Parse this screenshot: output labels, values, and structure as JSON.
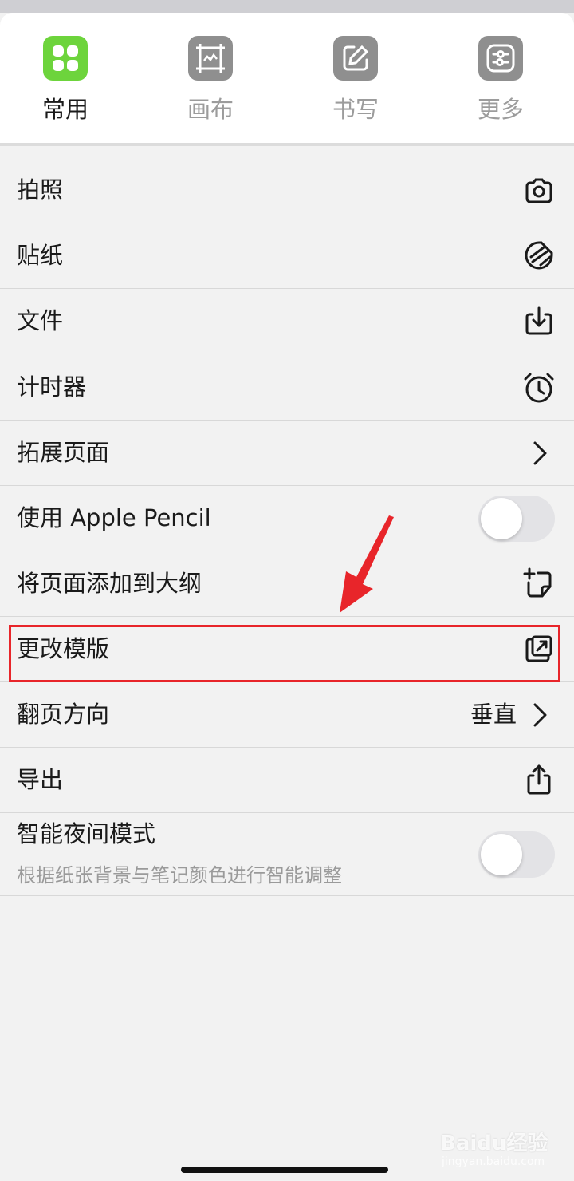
{
  "tabs": [
    {
      "label": "常用",
      "icon": "grid-icon",
      "active": true
    },
    {
      "label": "画布",
      "icon": "canvas-icon",
      "active": false
    },
    {
      "label": "书写",
      "icon": "pencil-icon",
      "active": false
    },
    {
      "label": "更多",
      "icon": "sliders-icon",
      "active": false
    }
  ],
  "rows": {
    "photo": {
      "label": "拍照",
      "icon": "camera-icon"
    },
    "sticker": {
      "label": "贴纸",
      "icon": "sticker-icon"
    },
    "file": {
      "label": "文件",
      "icon": "download-icon"
    },
    "timer": {
      "label": "计时器",
      "icon": "alarm-clock-icon"
    },
    "extend_page": {
      "label": "拓展页面",
      "icon": "chevron-right-icon"
    },
    "apple_pencil": {
      "label": "使用 Apple Pencil",
      "toggle_on": false
    },
    "add_outline": {
      "label": "将页面添加到大纲",
      "icon": "add-page-icon"
    },
    "change_template": {
      "label": "更改模版",
      "icon": "external-link-icon"
    },
    "page_direction": {
      "label": "翻页方向",
      "value": "垂直",
      "icon": "chevron-right-icon"
    },
    "export": {
      "label": "导出",
      "icon": "share-icon"
    },
    "night_mode": {
      "label": "智能夜间模式",
      "sub": "根据纸张背景与笔记颜色进行智能调整",
      "toggle_on": false
    }
  },
  "watermark": {
    "text": "Baidu经验",
    "sub": "jingyan.baidu.com"
  },
  "colors": {
    "accent": "#6dd43c",
    "highlight": "#e8252a",
    "tab_inactive": "#8f8f8f"
  }
}
